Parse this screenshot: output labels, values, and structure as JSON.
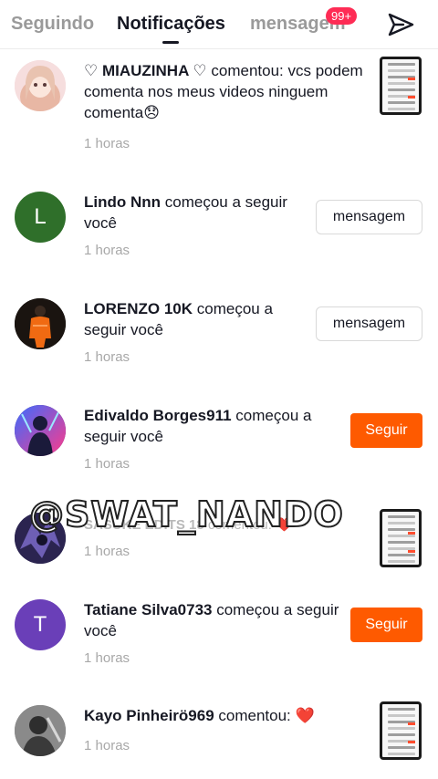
{
  "header": {
    "tabs": [
      {
        "label": "Seguindo"
      },
      {
        "label": "Notificações"
      },
      {
        "label": "mensagem"
      }
    ],
    "messages_badge": "99+",
    "send_icon": "send-icon"
  },
  "colors": {
    "accent_follow": "#fe5a00",
    "badge": "#fe2c55",
    "text": "#161823",
    "muted": "#a8a8a8"
  },
  "notifications": [
    {
      "user": "♡ MIAUZINHA ♡",
      "action": " comentou: vcs podem comenta nos meus videos ninguem comenta😞",
      "time": "1 horas"
    },
    {
      "user": "Lindo Nnn",
      "action": " começou a seguir você",
      "time": "1 horas",
      "button": "mensagem",
      "avatar_letter": "L"
    },
    {
      "user": "LORENZO 10K",
      "action": " começou a seguir você",
      "time": "1 horas",
      "button": "mensagem"
    },
    {
      "user": "Edivaldo Borges911",
      "action": " começou a seguir você",
      "time": "1 horas",
      "button": "Seguir"
    },
    {
      "user": "SASUKE EDITS 18",
      "action": " comentou: ❤️",
      "time": "1 horas"
    },
    {
      "user": "Tatiane Silva0733",
      "action": " começou a seguir você",
      "time": "1 horas",
      "button": "Seguir",
      "avatar_letter": "T"
    },
    {
      "user": "Kayo Pinheirö969",
      "action": " comentou: ❤️",
      "time": "1 horas"
    }
  ],
  "watermark": "@SWAT_NANDO"
}
